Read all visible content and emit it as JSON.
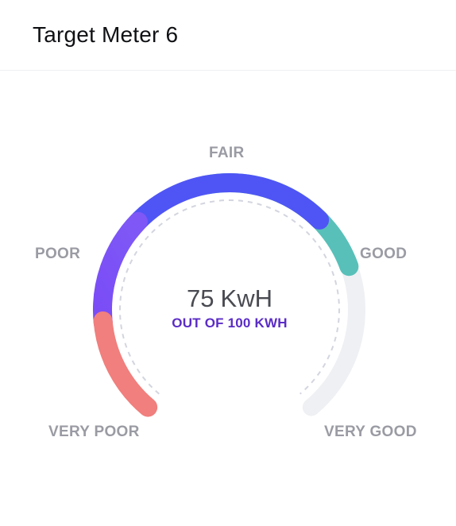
{
  "title": "Target Meter 6",
  "gauge": {
    "value": 75,
    "max": 100,
    "value_text": "75",
    "unit": "KwH",
    "subtitle": "OUT OF 100 KWH",
    "labels": {
      "very_poor": "VERY POOR",
      "poor": "POOR",
      "fair": "FAIR",
      "good": "GOOD",
      "very_good": "VERY GOOD"
    },
    "colors": {
      "very_poor": "#f07f7d",
      "poor": "#7b52f6",
      "fair": "#4f55f4",
      "good": "#58c0b9",
      "track": "#eff0f3",
      "dashes": "#d3d5df"
    }
  }
}
